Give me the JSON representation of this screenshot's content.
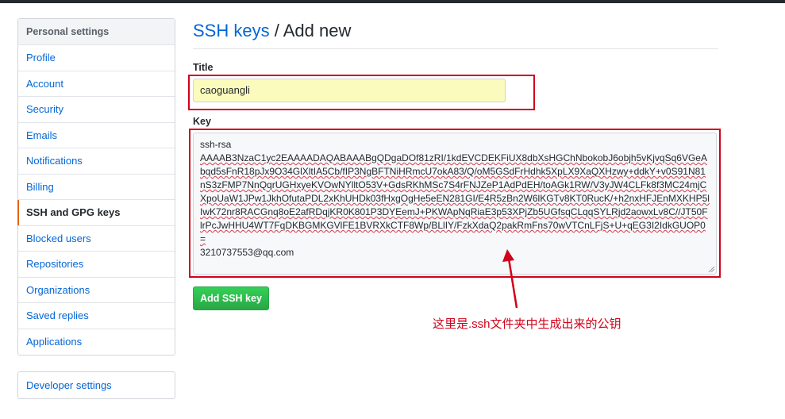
{
  "sidebar": {
    "heading": "Personal settings",
    "items": [
      {
        "label": "Profile"
      },
      {
        "label": "Account"
      },
      {
        "label": "Security"
      },
      {
        "label": "Emails"
      },
      {
        "label": "Notifications"
      },
      {
        "label": "Billing"
      },
      {
        "label": "SSH and GPG keys",
        "selected": true
      },
      {
        "label": "Blocked users"
      },
      {
        "label": "Repositories"
      },
      {
        "label": "Organizations"
      },
      {
        "label": "Saved replies"
      },
      {
        "label": "Applications"
      }
    ],
    "developer_settings": "Developer settings"
  },
  "header": {
    "breadcrumb_link": "SSH keys",
    "separator": " / ",
    "current": "Add new"
  },
  "form": {
    "title_label": "Title",
    "title_value": "caoguangli",
    "key_label": "Key",
    "key_prefix": "ssh-rsa",
    "key_body": "AAAAB3NzaC1yc2EAAAADAQABAAABgQDgaDOf81zRI/1kdEVCDEKFiUX8dbXsHGChNbokobJ6objh5vKjvqSq6VGeAbqd5sFnR18pJx9O34GlXltIA5Cb/fIP3NgBFTNiHRmcU7okA83/Q/oM5GSdFrHdhk5XpLX9XaQXHzwy+ddkY+v0S91N81nS3zFMP7NnQqrUGHxyeKVOwNYlltO53V+GdsRKhMSc7S4rFNJZeP1AdPdEH/toAGk1RW/V3yJW4CLFk8f3MC24mjCXpoUaW1JPw1JkhOfutaPDL2xKhUHDk03fHxgOgHe5eEN281GI/E4R5zBn2W6lKGTv8KT0RucK/+h2nxHFJEnMXKHP5lIwK72nr8RACGnq8oE2afRDqjKR0K801P3DYEemJ+PKWApNqRiaE3p53XPjZb5UGfsqCLqqSYLRjd2aowxLv8C//JT50FlrPcJwHHU4WT7FqDKBGMKGVlFE1BVRXkCTF8Wp/BLlIY/FzkXdaQ2pakRmFns70wVTCnLFjS+U+qEG3I2IdkGUOP0=",
    "key_suffix": "3210737553@qq.com",
    "submit_label": "Add SSH key"
  },
  "annotation": {
    "text": "这里是.ssh文件夹中生成出来的公钥",
    "color": "#d0021b"
  },
  "colors": {
    "link": "#0366d6",
    "button_green": "#28a745",
    "selected_accent": "#e36209",
    "highlight_input": "#fafbbc"
  }
}
